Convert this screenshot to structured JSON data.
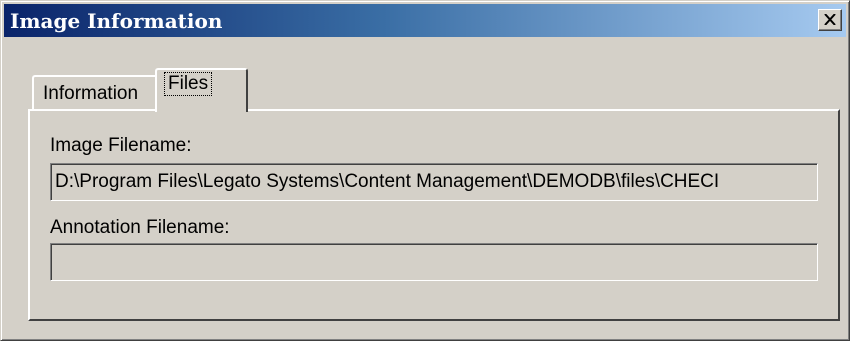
{
  "window": {
    "title": "Image Information",
    "close_icon": "close-icon"
  },
  "tabs": [
    {
      "label": "Information",
      "selected": false
    },
    {
      "label": "Files",
      "selected": true
    }
  ],
  "files_panel": {
    "image_filename_label": "Image Filename:",
    "image_filename_value": "D:\\Program Files\\Legato Systems\\Content Management\\DEMODB\\files\\CHECI",
    "annotation_filename_label": "Annotation Filename:",
    "annotation_filename_value": ""
  },
  "colors": {
    "title_gradient_start": "#0a246a",
    "title_gradient_end": "#a6caf0",
    "face": "#d4d0c8"
  }
}
